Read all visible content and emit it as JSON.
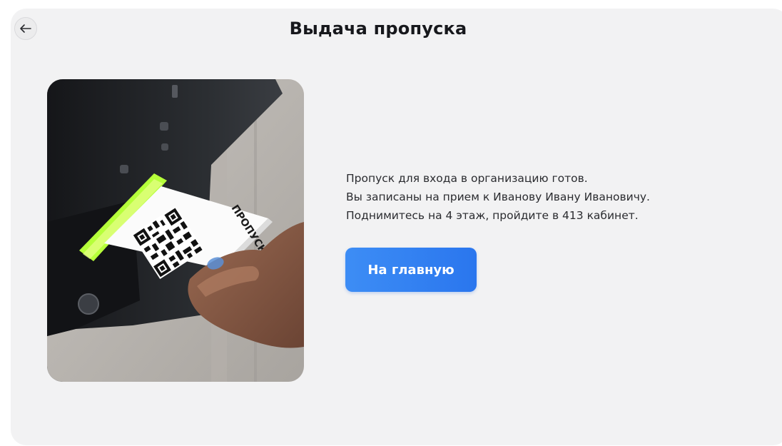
{
  "header": {
    "title": "Выдача пропуска",
    "back_icon": "arrow-left-icon"
  },
  "photo": {
    "ticket_text": "ПРОПУСК"
  },
  "message": {
    "lines": [
      "Пропуск для входа в организацию готов.",
      "Вы записаны на прием к Иванову Ивану Ивановичу.",
      "Поднимитесь на 4 этаж, пройдите в 413 кабинет."
    ]
  },
  "actions": {
    "home_label": "На главную"
  },
  "colors": {
    "background": "#f2f2f3",
    "button": "#2f7ff0",
    "text": "#2b2c30"
  }
}
